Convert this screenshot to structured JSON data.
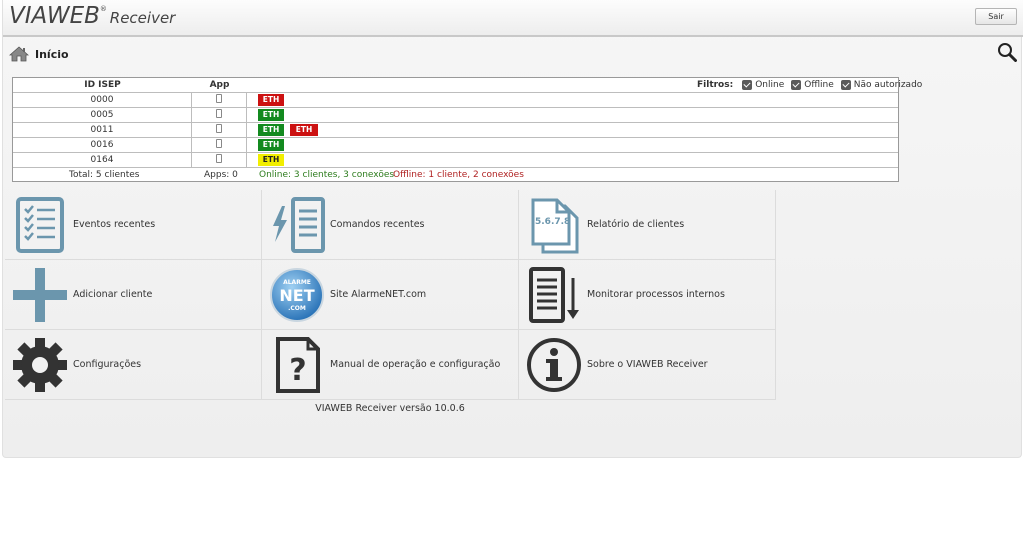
{
  "header": {
    "brand": "VIAWEB",
    "brand_reg": "®",
    "brand_sub": "Receiver",
    "exit_label": "Sair"
  },
  "breadcrumb": {
    "title": "Início"
  },
  "device_table": {
    "col_id": "ID ISEP",
    "col_app": "App",
    "filters_label": "Filtros:",
    "filters": [
      "Online",
      "Offline",
      "Não autorizado"
    ],
    "rows": [
      {
        "id": "0000",
        "conns": [
          {
            "label": "ETH",
            "status": "offline"
          }
        ]
      },
      {
        "id": "0005",
        "conns": [
          {
            "label": "ETH",
            "status": "online"
          }
        ]
      },
      {
        "id": "0011",
        "conns": [
          {
            "label": "ETH",
            "status": "online"
          },
          {
            "label": "ETH",
            "status": "offline"
          }
        ]
      },
      {
        "id": "0016",
        "conns": [
          {
            "label": "ETH",
            "status": "online"
          }
        ]
      },
      {
        "id": "0164",
        "conns": [
          {
            "label": "ETH",
            "status": "unauthorized"
          }
        ]
      }
    ],
    "totals": {
      "total": "Total: 5 clientes",
      "apps": "Apps: 0",
      "online": "Online: 3 clientes, 3 conexões",
      "offline": "Offline: 1 cliente, 2 conexões"
    }
  },
  "status_colors": {
    "online": "#138a1f",
    "offline": "#cc1111",
    "unauthorized": "#f2ee00"
  },
  "tiles": [
    {
      "icon": "checklist-icon",
      "label": "Eventos recentes"
    },
    {
      "icon": "bolt-document-icon",
      "label": "Comandos recentes"
    },
    {
      "icon": "report-icon",
      "label": "Relatório de clientes",
      "icon_text": "5.6.7.8"
    },
    {
      "icon": "plus-icon",
      "label": "Adicionar cliente"
    },
    {
      "icon": "alarmenet-logo-icon",
      "label": "Site AlarmeNET.com",
      "icon_text": [
        "ALARME",
        "NET",
        ".COM"
      ]
    },
    {
      "icon": "document-scroll-icon",
      "label": "Monitorar processos internos"
    },
    {
      "icon": "gear-icon",
      "label": "Configurações"
    },
    {
      "icon": "help-document-icon",
      "label": "Manual de operação e configuração"
    },
    {
      "icon": "info-icon",
      "label": "Sobre o VIAWEB Receiver"
    }
  ],
  "footer": {
    "version": "VIAWEB Receiver versão 10.0.6"
  }
}
